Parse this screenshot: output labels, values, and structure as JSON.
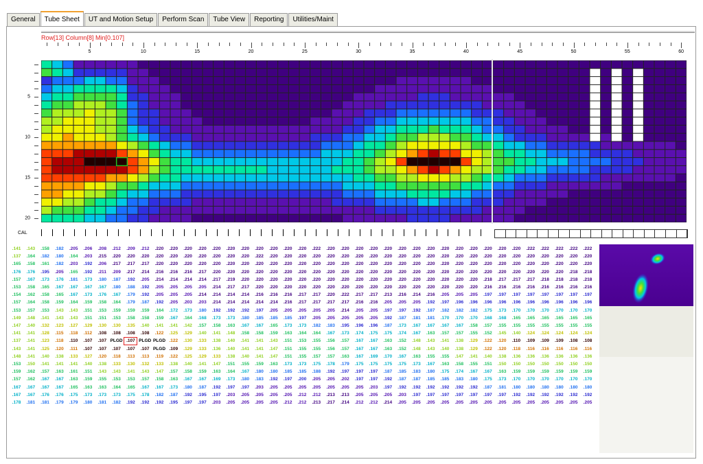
{
  "tabs": [
    {
      "label": "General",
      "active": false
    },
    {
      "label": "Tube Sheet",
      "active": true
    },
    {
      "label": "UT and Motion Setup",
      "active": false
    },
    {
      "label": "Perform Scan",
      "active": false
    },
    {
      "label": "Tube View",
      "active": false
    },
    {
      "label": "Reporting",
      "active": false
    },
    {
      "label": "Utilities/Maint",
      "active": false
    }
  ],
  "status_readout": "Row[13] Column[8] Min[0.107]",
  "tube_sheet": {
    "columns": 60,
    "rows": 20,
    "column_labels": [
      "5",
      "10",
      "15",
      "20",
      "25",
      "30",
      "35",
      "40",
      "45",
      "50",
      "55",
      "60"
    ],
    "row_labels": [
      "5",
      "10",
      "15",
      "20"
    ],
    "cal_label": "CAL",
    "selected": {
      "row": 13,
      "column": 8
    }
  },
  "colors": {
    "scale": [
      "#400080",
      "#5a10b0",
      "#3030e0",
      "#1a70ff",
      "#00c8e8",
      "#00e8a0",
      "#40e040",
      "#b0f020",
      "#f0f000",
      "#ffa000",
      "#ff4000",
      "#b00000",
      "#200000"
    ],
    "selected_border": "#e02020",
    "plugged": "#ffffff"
  },
  "data_table": {
    "rows": [
      [
        ".141",
        ".143",
        ".158",
        ".182",
        ".205",
        ".206",
        ".208",
        ".212",
        ".209",
        ".212",
        ".220",
        ".220",
        ".220",
        ".220",
        ".220",
        ".220",
        ".220",
        ".220",
        ".220",
        ".220",
        ".220",
        ".222",
        ".220",
        ".220",
        ".220",
        ".220",
        ".220",
        ".220",
        ".220",
        ".220",
        ".220",
        ".220",
        ".220",
        ".220",
        ".220",
        ".220",
        ".222",
        ".222",
        ".222",
        ".222",
        ".222"
      ],
      [
        ".137",
        ".164",
        ".182",
        ".180",
        ".164",
        ".203",
        ".215",
        ".220",
        ".220",
        ".220",
        ".220",
        ".220",
        ".220",
        ".220",
        ".220",
        ".220",
        ".220",
        ".222",
        ".220",
        ".220",
        ".220",
        ".220",
        ".220",
        ".220",
        ".220",
        ".220",
        ".220",
        ".220",
        ".220",
        ".220",
        ".220",
        ".220",
        ".220",
        ".220",
        ".220",
        ".220",
        ".220",
        ".220",
        ".220",
        ".220",
        ".220"
      ],
      [
        ".165",
        ".158",
        ".161",
        ".182",
        ".203",
        ".192",
        ".206",
        ".217",
        ".217",
        ".217",
        ".220",
        ".220",
        ".220",
        ".220",
        ".220",
        ".220",
        ".220",
        ".220",
        ".220",
        ".220",
        ".220",
        ".220",
        ".220",
        ".220",
        ".220",
        ".220",
        ".220",
        ".220",
        ".220",
        ".220",
        ".220",
        ".220",
        ".220",
        ".220",
        ".220",
        ".220",
        ".220",
        ".220",
        ".220",
        ".220",
        ".220"
      ],
      [
        ".176",
        ".176",
        ".195",
        ".205",
        ".165",
        ".192",
        ".211",
        ".209",
        ".217",
        ".214",
        ".216",
        ".216",
        ".216",
        ".217",
        ".220",
        ".220",
        ".220",
        ".220",
        ".220",
        ".220",
        ".220",
        ".220",
        ".220",
        ".220",
        ".220",
        ".220",
        ".220",
        ".220",
        ".220",
        ".220",
        ".220",
        ".220",
        ".220",
        ".220",
        ".220",
        ".220",
        ".220",
        ".220",
        ".220",
        ".218",
        ".218"
      ],
      [
        ".157",
        ".167",
        ".173",
        ".176",
        ".181",
        ".173",
        ".180",
        ".187",
        ".192",
        ".205",
        ".214",
        ".214",
        ".214",
        ".214",
        ".217",
        ".219",
        ".220",
        ".220",
        ".220",
        ".220",
        ".220",
        ".220",
        ".220",
        ".220",
        ".220",
        ".220",
        ".220",
        ".220",
        ".220",
        ".220",
        ".220",
        ".220",
        ".220",
        ".218",
        ".217",
        ".217",
        ".217",
        ".218",
        ".218",
        ".218",
        ".218"
      ],
      [
        ".153",
        ".158",
        ".165",
        ".167",
        ".167",
        ".167",
        ".167",
        ".180",
        ".188",
        ".192",
        ".205",
        ".205",
        ".205",
        ".205",
        ".214",
        ".217",
        ".217",
        ".220",
        ".220",
        ".220",
        ".220",
        ".220",
        ".220",
        ".220",
        ".220",
        ".220",
        ".220",
        ".220",
        ".220",
        ".220",
        ".220",
        ".220",
        ".220",
        ".216",
        ".216",
        ".216",
        ".216",
        ".216",
        ".216",
        ".216",
        ".216"
      ],
      [
        ".154",
        ".162",
        ".158",
        ".165",
        ".167",
        ".173",
        ".176",
        ".167",
        ".179",
        ".192",
        ".205",
        ".205",
        ".205",
        ".214",
        ".214",
        ".214",
        ".214",
        ".216",
        ".216",
        ".216",
        ".217",
        ".217",
        ".220",
        ".222",
        ".217",
        ".217",
        ".213",
        ".216",
        ".214",
        ".216",
        ".205",
        ".205",
        ".205",
        ".197",
        ".197",
        ".197",
        ".197",
        ".197",
        ".197",
        ".197",
        ".197"
      ],
      [
        ".157",
        ".164",
        ".158",
        ".159",
        ".164",
        ".159",
        ".158",
        ".164",
        ".179",
        ".187",
        ".192",
        ".205",
        ".203",
        ".203",
        ".214",
        ".214",
        ".214",
        ".214",
        ".214",
        ".216",
        ".217",
        ".217",
        ".217",
        ".217",
        ".216",
        ".216",
        ".205",
        ".205",
        ".205",
        ".192",
        ".197",
        ".196",
        ".196",
        ".196",
        ".196",
        ".196",
        ".196",
        ".196",
        ".196",
        ".196",
        ".196"
      ],
      [
        ".153",
        ".157",
        ".153",
        ".143",
        ".143",
        ".151",
        ".153",
        ".159",
        ".159",
        ".159",
        ".164",
        ".172",
        ".173",
        ".180",
        ".192",
        ".192",
        ".192",
        ".197",
        ".205",
        ".205",
        ".205",
        ".205",
        ".205",
        ".214",
        ".205",
        ".205",
        ".197",
        ".197",
        ".192",
        ".187",
        ".182",
        ".182",
        ".182",
        ".175",
        ".173",
        ".170",
        ".170",
        ".170",
        ".170",
        ".170",
        ".170"
      ],
      [
        ".149",
        ".148",
        ".141",
        ".143",
        ".143",
        ".151",
        ".151",
        ".153",
        ".158",
        ".158",
        ".159",
        ".167",
        ".164",
        ".168",
        ".173",
        ".173",
        ".180",
        ".185",
        ".185",
        ".185",
        ".197",
        ".205",
        ".205",
        ".205",
        ".205",
        ".205",
        ".192",
        ".187",
        ".181",
        ".181",
        ".170",
        ".170",
        ".170",
        ".168",
        ".168",
        ".165",
        ".165",
        ".165",
        ".165",
        ".165",
        ".165"
      ],
      [
        ".147",
        ".140",
        ".132",
        ".123",
        ".127",
        ".129",
        ".130",
        ".130",
        ".135",
        ".140",
        ".141",
        ".141",
        ".142",
        ".157",
        ".158",
        ".163",
        ".167",
        ".167",
        ".165",
        ".173",
        ".173",
        ".182",
        ".183",
        ".195",
        ".196",
        ".196",
        ".187",
        ".173",
        ".167",
        ".167",
        ".167",
        ".167",
        ".158",
        ".157",
        ".155",
        ".155",
        ".155",
        ".155",
        ".155",
        ".155",
        ".155"
      ],
      [
        ".141",
        ".141",
        ".128",
        ".115",
        ".118",
        ".112",
        ".108",
        ".108",
        ".108",
        ".108",
        ".122",
        ".125",
        ".129",
        ".140",
        ".141",
        ".148",
        ".158",
        ".158",
        ".159",
        ".163",
        ".164",
        ".164",
        ".167",
        ".173",
        ".174",
        ".175",
        ".175",
        ".174",
        ".167",
        ".163",
        ".157",
        ".157",
        ".155",
        ".152",
        ".145",
        ".140",
        ".124",
        ".124",
        ".124",
        ".124",
        ".124"
      ],
      [
        ".137",
        ".141",
        ".123",
        ".118",
        ".110",
        ".107",
        ".107",
        "PLGD",
        ".107",
        "PLGD",
        "PLGD",
        ".122",
        ".130",
        ".133",
        ".138",
        ".140",
        ".141",
        ".141",
        ".143",
        ".151",
        ".153",
        ".155",
        ".156",
        ".157",
        ".167",
        ".167",
        ".163",
        ".152",
        ".148",
        ".143",
        ".141",
        ".138",
        ".129",
        ".122",
        ".120",
        ".110",
        ".109",
        ".109",
        ".109",
        ".108",
        ".108"
      ],
      [
        ".143",
        ".141",
        ".125",
        ".120",
        ".111",
        ".107",
        ".107",
        ".107",
        ".107",
        ".107",
        "PLGD",
        ".109",
        ".129",
        ".133",
        ".136",
        ".140",
        ".141",
        ".141",
        ".147",
        ".151",
        ".155",
        ".155",
        ".156",
        ".157",
        ".167",
        ".167",
        ".163",
        ".152",
        ".148",
        ".143",
        ".140",
        ".138",
        ".129",
        ".122",
        ".120",
        ".118",
        ".116",
        ".116",
        ".116",
        ".116",
        ".116"
      ],
      [
        ".148",
        ".141",
        ".140",
        ".138",
        ".133",
        ".127",
        ".120",
        ".118",
        ".113",
        ".113",
        ".119",
        ".122",
        ".125",
        ".129",
        ".133",
        ".138",
        ".140",
        ".141",
        ".147",
        ".151",
        ".155",
        ".157",
        ".157",
        ".163",
        ".167",
        ".169",
        ".170",
        ".167",
        ".163",
        ".155",
        ".155",
        ".147",
        ".141",
        ".140",
        ".138",
        ".136",
        ".136",
        ".136",
        ".136",
        ".136",
        ".136"
      ],
      [
        ".153",
        ".150",
        ".141",
        ".141",
        ".141",
        ".140",
        ".138",
        ".133",
        ".130",
        ".132",
        ".133",
        ".138",
        ".140",
        ".141",
        ".147",
        ".151",
        ".155",
        ".159",
        ".163",
        ".173",
        ".173",
        ".175",
        ".178",
        ".179",
        ".175",
        ".175",
        ".175",
        ".175",
        ".173",
        ".167",
        ".163",
        ".158",
        ".155",
        ".151",
        ".150",
        ".150",
        ".150",
        ".150",
        ".150",
        ".150",
        ".150"
      ],
      [
        ".159",
        ".162",
        ".157",
        ".163",
        ".161",
        ".151",
        ".143",
        ".143",
        ".141",
        ".143",
        ".147",
        ".157",
        ".158",
        ".159",
        ".163",
        ".164",
        ".167",
        ".180",
        ".180",
        ".185",
        ".185",
        ".188",
        ".192",
        ".197",
        ".197",
        ".197",
        ".187",
        ".185",
        ".183",
        ".180",
        ".175",
        ".174",
        ".167",
        ".167",
        ".163",
        ".159",
        ".159",
        ".159",
        ".159",
        ".159",
        ".159"
      ],
      [
        ".157",
        ".162",
        ".167",
        ".167",
        ".163",
        ".159",
        ".155",
        ".153",
        ".153",
        ".157",
        ".158",
        ".163",
        ".167",
        ".167",
        ".169",
        ".173",
        ".180",
        ".183",
        ".192",
        ".197",
        ".200",
        ".205",
        ".205",
        ".202",
        ".197",
        ".197",
        ".192",
        ".187",
        ".187",
        ".185",
        ".185",
        ".183",
        ".180",
        ".175",
        ".173",
        ".170",
        ".170",
        ".170",
        ".170",
        ".170",
        ".170"
      ],
      [
        ".167",
        ".167",
        ".167",
        ".167",
        ".165",
        ".163",
        ".163",
        ".164",
        ".165",
        ".167",
        ".167",
        ".173",
        ".180",
        ".187",
        ".192",
        ".197",
        ".197",
        ".203",
        ".205",
        ".205",
        ".205",
        ".205",
        ".205",
        ".205",
        ".205",
        ".203",
        ".197",
        ".192",
        ".192",
        ".192",
        ".192",
        ".192",
        ".192",
        ".187",
        ".181",
        ".180",
        ".180",
        ".180",
        ".180",
        ".180",
        ".180"
      ],
      [
        ".167",
        ".167",
        ".176",
        ".176",
        ".175",
        ".173",
        ".173",
        ".173",
        ".175",
        ".178",
        ".182",
        ".187",
        ".192",
        ".195",
        ".197",
        ".203",
        ".205",
        ".205",
        ".205",
        ".205",
        ".212",
        ".212",
        ".213",
        ".213",
        ".205",
        ".205",
        ".205",
        ".203",
        ".197",
        ".197",
        ".197",
        ".197",
        ".197",
        ".197",
        ".197",
        ".192",
        ".192",
        ".192",
        ".192",
        ".192",
        ".192"
      ],
      [
        ".178",
        ".181",
        ".181",
        ".179",
        ".179",
        ".180",
        ".181",
        ".182",
        ".192",
        ".192",
        ".192",
        ".195",
        ".197",
        ".197",
        ".203",
        ".205",
        ".205",
        ".205",
        ".205",
        ".212",
        ".212",
        ".213",
        ".217",
        ".214",
        ".212",
        ".212",
        ".214",
        ".205",
        ".205",
        ".205",
        ".205",
        ".205",
        ".205",
        ".205",
        ".205",
        ".205",
        ".205",
        ".205",
        ".205",
        ".205",
        ".205"
      ]
    ]
  }
}
